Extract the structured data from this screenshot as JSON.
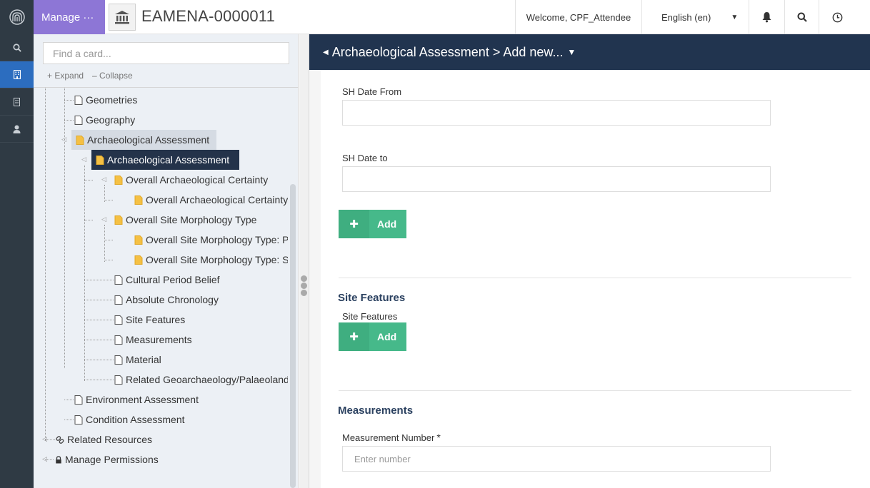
{
  "header": {
    "manage_label": "Manage ···",
    "resource_title": "EAMENA-0000011",
    "welcome": "Welcome, CPF_Attendee",
    "language": "English (en)"
  },
  "tree": {
    "search_placeholder": "Find a card...",
    "expand_label": "Expand",
    "collapse_label": "Collapse",
    "items": [
      "Geometries",
      "Geography",
      "Archaeological Assessment",
      "Archaeological Assessment",
      "Overall Archaeological Certainty",
      "Overall Archaeological Certainty V",
      "Overall Site Morphology Type",
      "Overall Site Morphology Type: Po",
      "Overall Site Morphology Type: Su",
      "Cultural Period Belief",
      "Absolute Chronology",
      "Site Features",
      "Measurements",
      "Material",
      "Related Geoarchaeology/Palaeolands",
      "Environment Assessment",
      "Condition Assessment",
      "Related Resources",
      "Manage Permissions"
    ]
  },
  "form": {
    "breadcrumb": "Archaeological Assessment > Add new...",
    "sh_date_from_label": "SH Date From",
    "sh_date_to_label": "SH Date to",
    "add_label": "Add",
    "site_features_title": "Site Features",
    "site_features_label": "Site Features",
    "measurements_title": "Measurements",
    "measurement_number_label": "Measurement Number",
    "measurement_required": "*",
    "measurement_placeholder": "Enter number"
  },
  "colors": {
    "manage_purple": "#8d76d6",
    "header_navy": "#21344f",
    "add_green": "#46b98a",
    "nav_dark": "#2f3a44",
    "nav_active": "#2c6dbf",
    "folder_yellow": "#f5c043"
  },
  "icons": [
    "arches-logo-icon",
    "bank-icon",
    "caret-down-icon",
    "bell-icon",
    "search-icon",
    "history-icon",
    "building-icon",
    "file-icon",
    "user-icon",
    "folder-icon",
    "link-icon",
    "lock-icon",
    "plus-icon"
  ]
}
